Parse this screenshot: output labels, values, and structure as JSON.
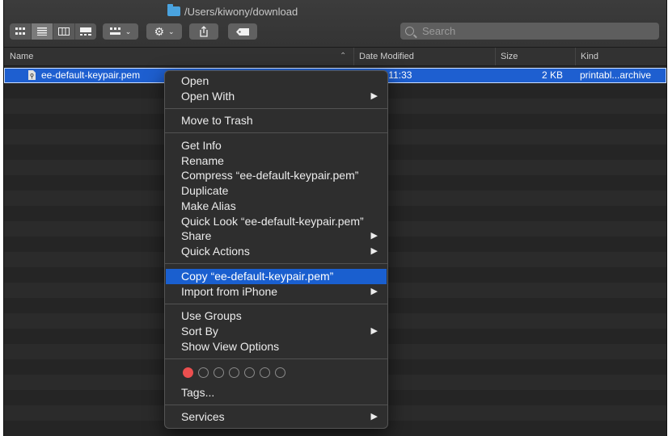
{
  "window": {
    "path": "/Users/kiwony/download"
  },
  "toolbar": {
    "view_icons": [
      "icon-view-icon",
      "list-view-icon",
      "column-view-icon",
      "gallery-view-icon"
    ],
    "search_placeholder": "Search"
  },
  "columns": {
    "name": "Name",
    "date": "Date Modified",
    "size": "Size",
    "kind": "Kind"
  },
  "file": {
    "name": "ee-default-keypair.pem",
    "date_partial": "y 11:33",
    "size": "2 KB",
    "kind": "printabl...archive"
  },
  "menu": {
    "items": [
      {
        "label": "Open"
      },
      {
        "label": "Open With",
        "submenu": true
      },
      {
        "label": "Move to Trash"
      },
      {
        "label": "Get Info"
      },
      {
        "label": "Rename"
      },
      {
        "label": "Compress “ee-default-keypair.pem”"
      },
      {
        "label": "Duplicate"
      },
      {
        "label": "Make Alias"
      },
      {
        "label": "Quick Look “ee-default-keypair.pem”"
      },
      {
        "label": "Share",
        "submenu": true
      },
      {
        "label": "Quick Actions",
        "submenu": true
      },
      {
        "label": "Copy “ee-default-keypair.pem”",
        "highlighted": true
      },
      {
        "label": "Import from iPhone",
        "submenu": true
      },
      {
        "label": "Use Groups"
      },
      {
        "label": "Sort By",
        "submenu": true
      },
      {
        "label": "Show View Options"
      },
      {
        "label": "Tags..."
      },
      {
        "label": "Services",
        "submenu": true
      }
    ],
    "tag_colors": [
      "#ec4f4f",
      "none",
      "none",
      "none",
      "none",
      "none",
      "none"
    ]
  },
  "colors": {
    "selection": "#1e5fd0",
    "menu_highlight": "#1a5fcf",
    "folder": "#4aa3df"
  }
}
